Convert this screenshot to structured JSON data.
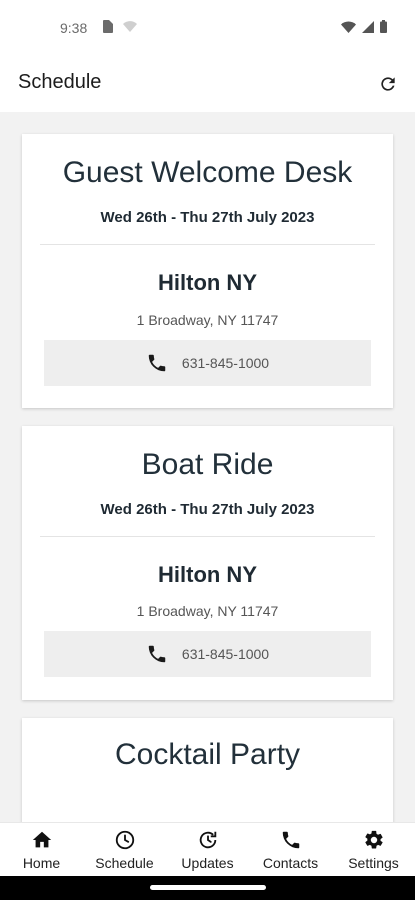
{
  "status_bar": {
    "time": "9:38"
  },
  "app_bar": {
    "title": "Schedule"
  },
  "events": [
    {
      "title": "Guest Welcome Desk",
      "dates": "Wed 26th - Thu 27th July 2023",
      "venue": "Hilton NY",
      "address": "1 Broadway, NY 11747",
      "phone": "631-845-1000"
    },
    {
      "title": "Boat Ride",
      "dates": "Wed 26th - Thu 27th July 2023",
      "venue": "Hilton NY",
      "address": "1 Broadway, NY 11747",
      "phone": "631-845-1000"
    },
    {
      "title": "Cocktail Party"
    }
  ],
  "bottom_nav": {
    "items": [
      {
        "label": "Home",
        "icon": "home-icon"
      },
      {
        "label": "Schedule",
        "icon": "clock-icon"
      },
      {
        "label": "Updates",
        "icon": "updates-icon"
      },
      {
        "label": "Contacts",
        "icon": "phone-icon"
      },
      {
        "label": "Settings",
        "icon": "gear-icon"
      }
    ]
  }
}
